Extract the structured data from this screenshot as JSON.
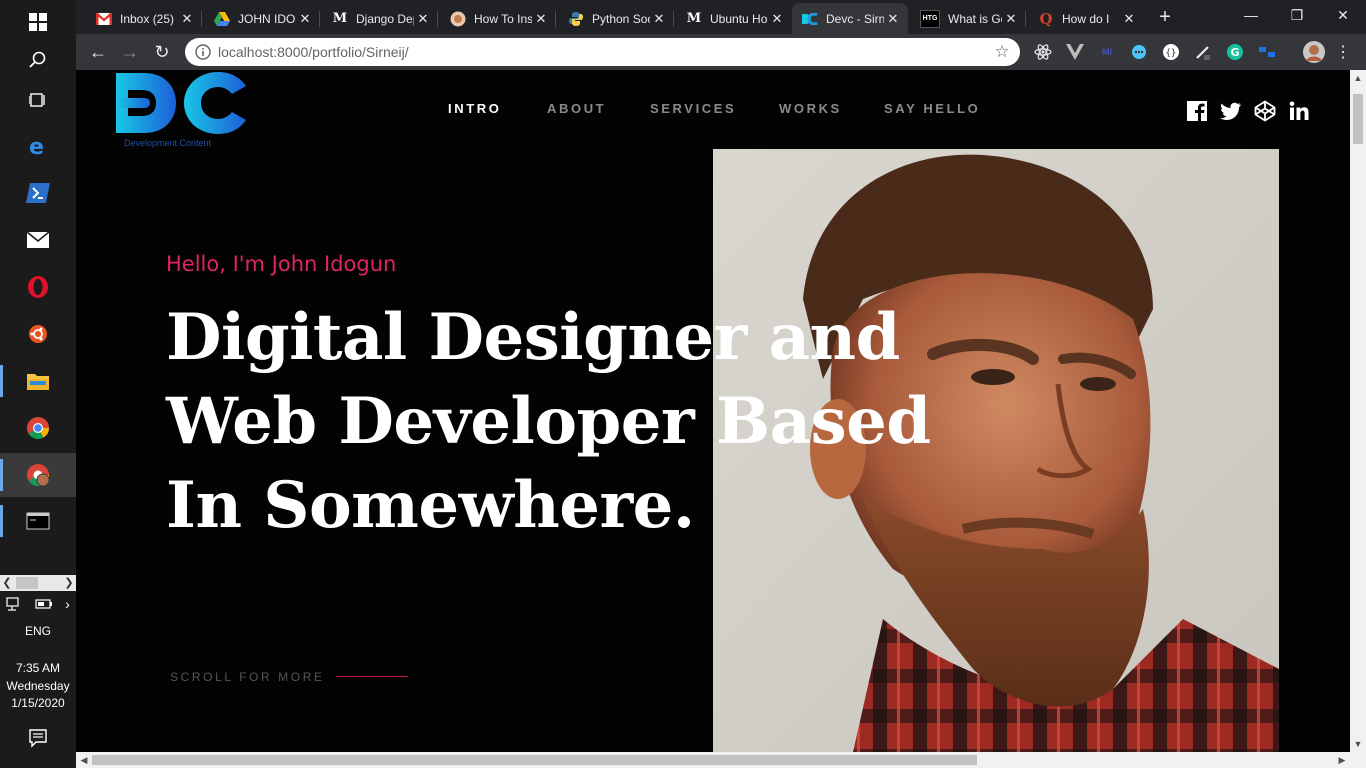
{
  "taskbar": {
    "icons": [
      "windows-start-icon",
      "search-icon",
      "task-view-icon",
      "edge-icon",
      "powershell-icon",
      "mail-icon",
      "opera-icon",
      "ubuntu-icon",
      "file-explorer-icon",
      "chrome-icon",
      "chrome-user-icon",
      "terminal-icon"
    ],
    "language": "ENG",
    "time": "7:35 AM",
    "day": "Wednesday",
    "date": "1/15/2020"
  },
  "tabs": [
    {
      "title": "Inbox (25)",
      "icon": "gmail-icon"
    },
    {
      "title": "JOHN IDOGUN",
      "icon": "google-drive-icon"
    },
    {
      "title": "Django Deployment",
      "icon": "medium-icon"
    },
    {
      "title": "How To Install",
      "icon": "digitalocean-icon"
    },
    {
      "title": "Python Social Auth",
      "icon": "python-icon"
    },
    {
      "title": "Ubuntu Hosting",
      "icon": "medium-icon"
    },
    {
      "title": "Devc - Sirneij",
      "icon": "dc-logo-icon",
      "active": true
    },
    {
      "title": "What is Google",
      "icon": "htg-icon"
    },
    {
      "title": "How do I",
      "icon": "quora-icon"
    }
  ],
  "omnibox": {
    "url": "localhost:8000/portfolio/Sirneij/"
  },
  "site": {
    "logo_subtitle": "Development Content",
    "nav": [
      {
        "label": "INTRO",
        "active": true
      },
      {
        "label": "ABOUT"
      },
      {
        "label": "SERVICES"
      },
      {
        "label": "WORKS"
      },
      {
        "label": "SAY HELLO"
      }
    ],
    "social": [
      "facebook-icon",
      "twitter-icon",
      "codepen-icon",
      "linkedin-icon"
    ],
    "hello": "Hello, I'm John Idogun",
    "headline": "Digital Designer and Web Developer Based In Somewhere.",
    "scroll_label": "SCROLL FOR MORE"
  },
  "colors": {
    "accent": "#e0245e",
    "logo_cyan": "#19c7e6",
    "logo_blue": "#1e5fd8",
    "page_bg": "#030303"
  }
}
